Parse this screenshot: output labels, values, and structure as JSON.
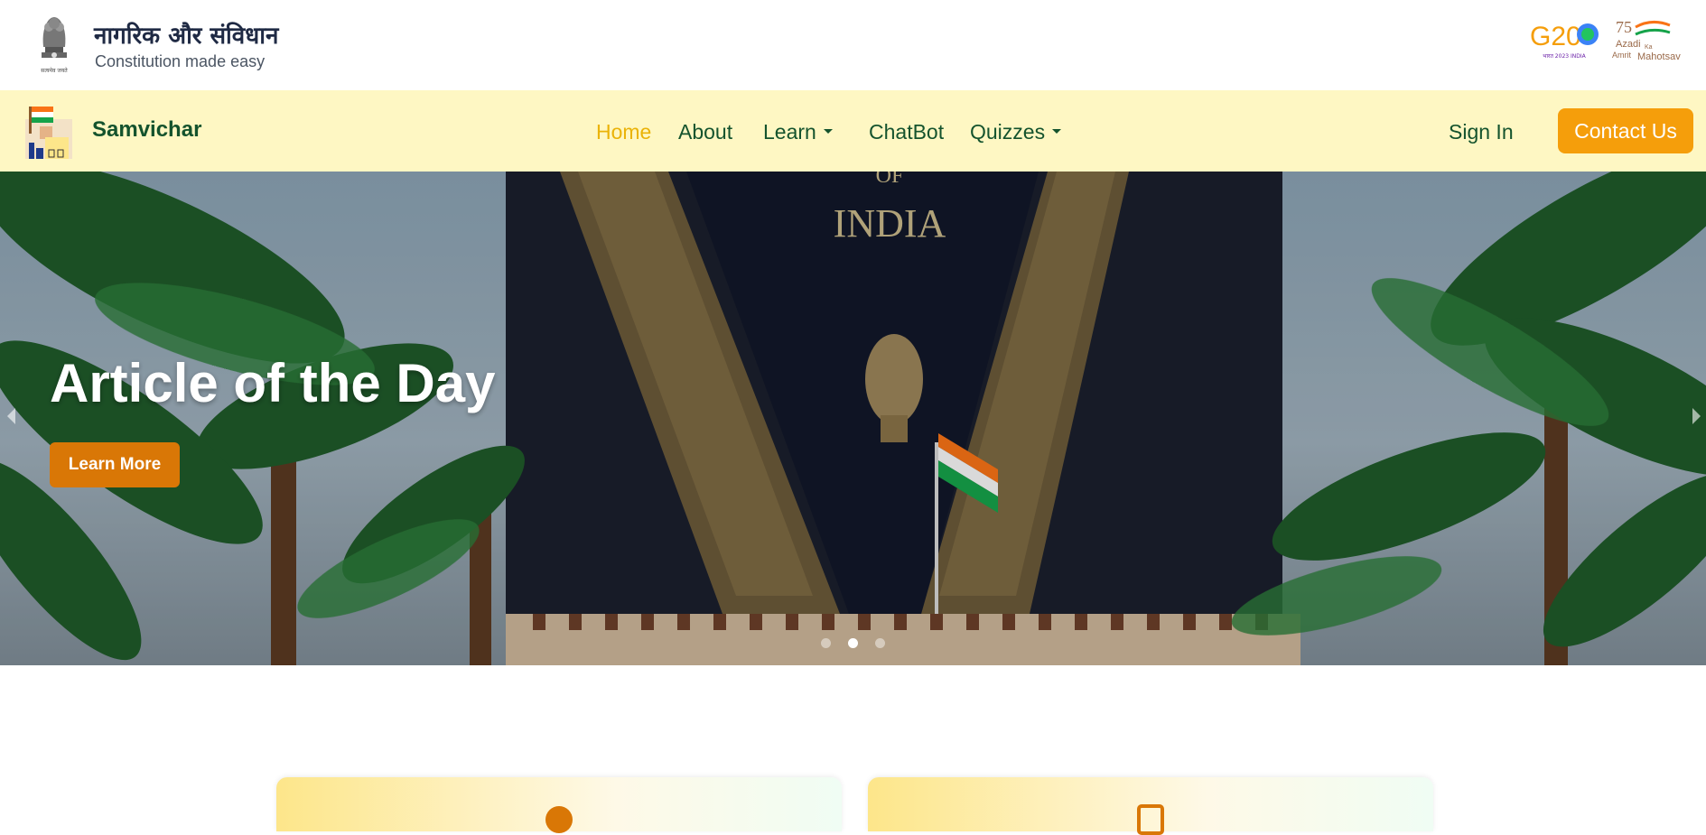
{
  "header": {
    "title_hindi": "नागरिक और संविधान",
    "subtitle": "Constitution made easy",
    "emblem_text": "सत्यमेव जयते",
    "g20_text": "G20",
    "g20_sub": "भारत 2023 INDIA",
    "aka_number": "75",
    "aka_line1": "Azadi",
    "aka_line2": "Ka",
    "aka_line3": "Amrit",
    "aka_line4": "Mahotsav"
  },
  "navbar": {
    "brand": "Samvichar",
    "items": [
      {
        "label": "Home",
        "active": true
      },
      {
        "label": "About"
      },
      {
        "label": "Learn",
        "dropdown": true
      },
      {
        "label": "ChatBot"
      },
      {
        "label": "Quizzes",
        "dropdown": true
      }
    ],
    "sign_in": "Sign In",
    "contact": "Contact Us"
  },
  "hero": {
    "title": "Article of the Day",
    "button": "Learn More",
    "background_text": "INDIA",
    "background_text_top": "OF",
    "active_slide": 2,
    "slides": 3
  },
  "colors": {
    "navbar_bg": "#fef7c3",
    "brand_green": "#14532d",
    "active_nav": "#eab308",
    "contact_button": "#f59e0b",
    "learn_button": "#d97706"
  }
}
